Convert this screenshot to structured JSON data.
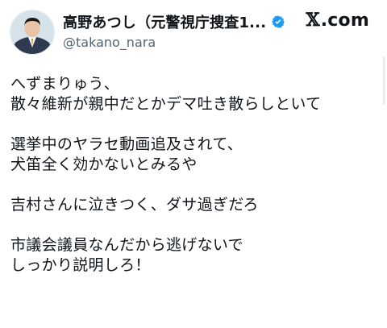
{
  "user": {
    "display_name": "高野あつし（元警視庁捜査1...",
    "handle": "@takano_nara"
  },
  "brand": {
    "x": "𝕏",
    "domain": ".com"
  },
  "tweet": {
    "paragraphs": [
      [
        "へずまりゅう、",
        "散々維新が親中だとかデマ吐き散らしといて"
      ],
      [
        "選挙中のヤラセ動画追及されて、",
        "犬笛全く効かないとみるや"
      ],
      [
        "吉村さんに泣きつく、ダサ過ぎだろ"
      ],
      [
        "市議会議員なんだから逃げないで",
        "しっかり説明しろ！"
      ]
    ]
  },
  "colors": {
    "text": "#0f1419",
    "secondary": "#536471",
    "verified_blue": "#1d9bf0"
  }
}
